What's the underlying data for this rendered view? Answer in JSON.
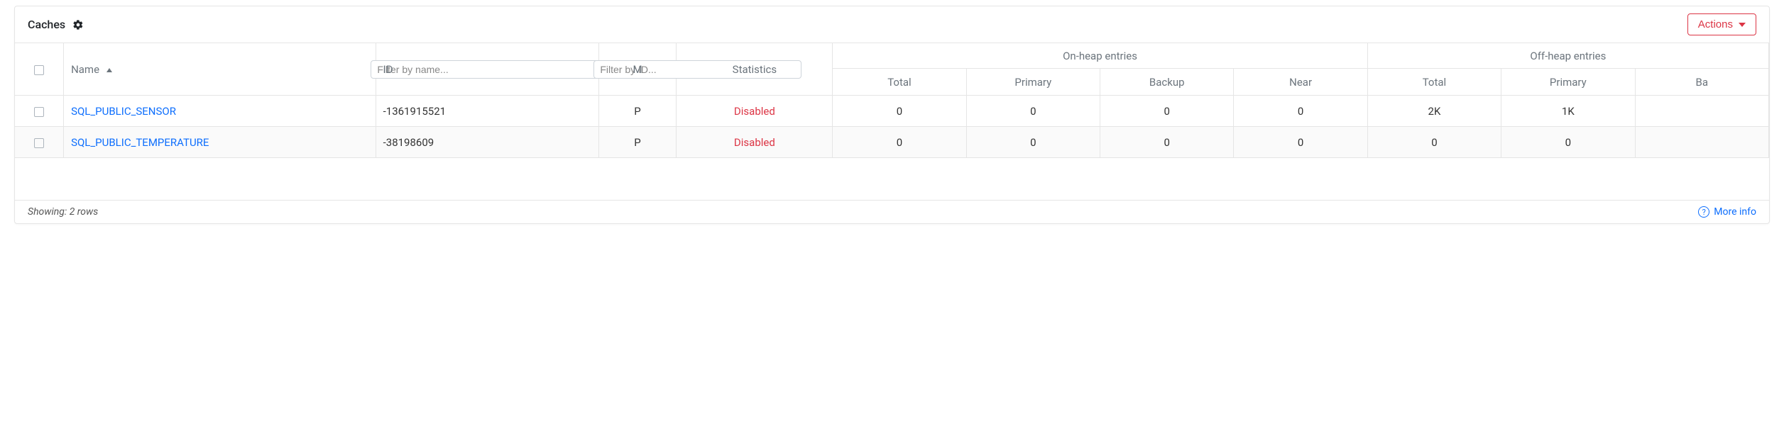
{
  "panel": {
    "title": "Caches",
    "actions_label": "Actions"
  },
  "columns": {
    "name": {
      "label": "Name",
      "placeholder": "Filter by name..."
    },
    "id": {
      "label": "ID",
      "placeholder": "Filter by ID..."
    },
    "m": "M",
    "statistics": "Statistics",
    "on_heap": {
      "group": "On-heap entries",
      "total": "Total",
      "primary": "Primary",
      "backup": "Backup",
      "near": "Near"
    },
    "off_heap": {
      "group": "Off-heap entries",
      "total": "Total",
      "primary": "Primary",
      "backup": "Ba"
    }
  },
  "rows": [
    {
      "name": "SQL_PUBLIC_SENSOR",
      "id": "-1361915521",
      "m": "P",
      "statistics": "Disabled",
      "on_total": "0",
      "on_primary": "0",
      "on_backup": "0",
      "on_near": "0",
      "off_total": "2K",
      "off_primary": "1K",
      "off_backup": ""
    },
    {
      "name": "SQL_PUBLIC_TEMPERATURE",
      "id": "-38198609",
      "m": "P",
      "statistics": "Disabled",
      "on_total": "0",
      "on_primary": "0",
      "on_backup": "0",
      "on_near": "0",
      "off_total": "0",
      "off_primary": "0",
      "off_backup": ""
    }
  ],
  "footer": {
    "showing": "Showing: 2 rows",
    "more_info": "More info"
  }
}
